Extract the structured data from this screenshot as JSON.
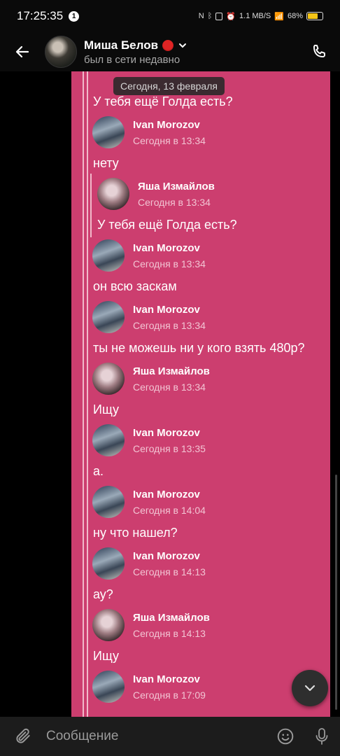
{
  "status_bar": {
    "time": "17:25:35",
    "notif_count": "1",
    "net_speed": "1.1 MB/S",
    "battery": "68%",
    "battery_level": 0.68
  },
  "header": {
    "name": "Миша Белов",
    "status": "был в сети недавно"
  },
  "chat": {
    "date_chip": "Сегодня, 13 февраля",
    "items": [
      {
        "type": "text",
        "text": "У тебя ещё Голда есть?"
      },
      {
        "type": "author",
        "name": "Ivan Morozov",
        "time": "Сегодня в 13:34",
        "avatar": "ivan"
      },
      {
        "type": "text",
        "text": "нету"
      },
      {
        "type": "author",
        "name": "Яша Измайлов",
        "time": "Сегодня в 13:34",
        "avatar": "yasha",
        "quoted": true
      },
      {
        "type": "text",
        "text": "У тебя ещё Голда есть?",
        "quoted": true
      },
      {
        "type": "author",
        "name": "Ivan Morozov",
        "time": "Сегодня в 13:34",
        "avatar": "ivan"
      },
      {
        "type": "text",
        "text": "он всю заскам"
      },
      {
        "type": "author",
        "name": "Ivan Morozov",
        "time": "Сегодня в 13:34",
        "avatar": "ivan"
      },
      {
        "type": "text",
        "text": "ты не можешь ни у кого взять 480р?"
      },
      {
        "type": "author",
        "name": "Яша Измайлов",
        "time": "Сегодня в 13:34",
        "avatar": "yasha"
      },
      {
        "type": "text",
        "text": "Ищу"
      },
      {
        "type": "author",
        "name": "Ivan Morozov",
        "time": "Сегодня в 13:35",
        "avatar": "ivan"
      },
      {
        "type": "text",
        "text": "а."
      },
      {
        "type": "author",
        "name": "Ivan Morozov",
        "time": "Сегодня в 14:04",
        "avatar": "ivan"
      },
      {
        "type": "text",
        "text": "ну что нашел?"
      },
      {
        "type": "author",
        "name": "Ivan Morozov",
        "time": "Сегодня в 14:13",
        "avatar": "ivan"
      },
      {
        "type": "text",
        "text": "ау?"
      },
      {
        "type": "author",
        "name": "Яша Измайлов",
        "time": "Сегодня в 14:13",
        "avatar": "yasha"
      },
      {
        "type": "text",
        "text": "Ищу"
      },
      {
        "type": "author",
        "name": "Ivan Morozov",
        "time": "Сегодня в 17:09",
        "avatar": "ivan"
      }
    ]
  },
  "composer": {
    "placeholder": "Сообщение"
  },
  "icons": {
    "back": "arrow-left-icon",
    "call": "phone-icon",
    "chevron": "chevron-down-icon",
    "attach": "paperclip-icon",
    "emoji": "smile-icon",
    "mic": "microphone-icon",
    "scroll_down": "chevron-down-icon"
  },
  "colors": {
    "panel": "#cc3e6f",
    "time_text": "#f2c4d3",
    "background": "#000000"
  }
}
